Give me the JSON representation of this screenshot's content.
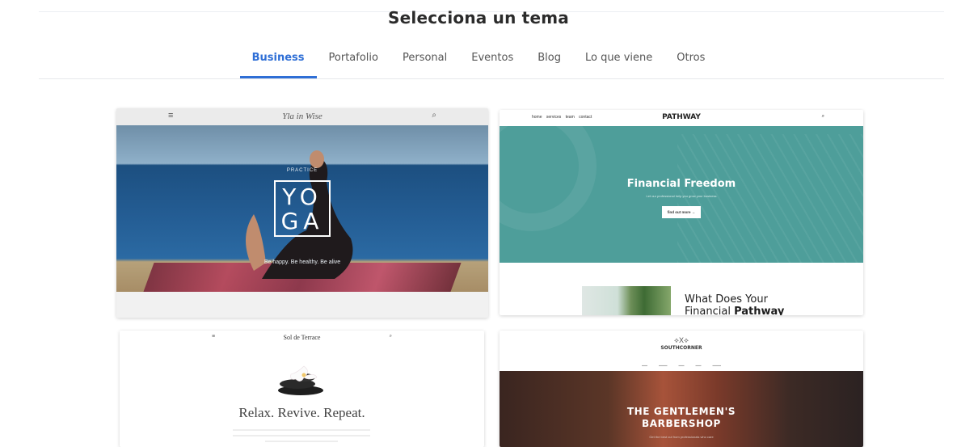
{
  "title": "Selecciona un tema",
  "tabs": [
    {
      "label": "Business",
      "active": true
    },
    {
      "label": "Portafolio"
    },
    {
      "label": "Personal"
    },
    {
      "label": "Eventos"
    },
    {
      "label": "Blog"
    },
    {
      "label": "Lo que viene"
    },
    {
      "label": "Otros"
    }
  ],
  "colors": {
    "accent": "#2f6fd6"
  },
  "themes": [
    {
      "logo": "Yla in Wise",
      "menu_icon": "≡",
      "search_icon": "⌕",
      "eyebrow": "PRACTICE",
      "hero_title": "YO GA",
      "hero_sub": "Be happy. Be healthy. Be alive"
    },
    {
      "nav_links": "home  services  team  contact",
      "logo": "PATHWAY",
      "hero_title": "Financial Freedom",
      "hero_sub": "Let our professional help you grow your business",
      "button": "find out more →",
      "heading_line1": "What Does Your",
      "heading_line2a": "Financial ",
      "heading_line2b": "Pathway"
    },
    {
      "logo": "Sol de Terrace",
      "menu_icon": "≡",
      "search_icon": "⌕",
      "headline": "Relax. Revive. Repeat."
    },
    {
      "logo_mark": "⟡X⟡",
      "logo": "SOUTHCORNER",
      "hero_title_line1": "THE GENTLEMEN'S",
      "hero_title_line2": "BARBERSHOP",
      "hero_sub": "Get the best cut from professionals who care"
    }
  ]
}
